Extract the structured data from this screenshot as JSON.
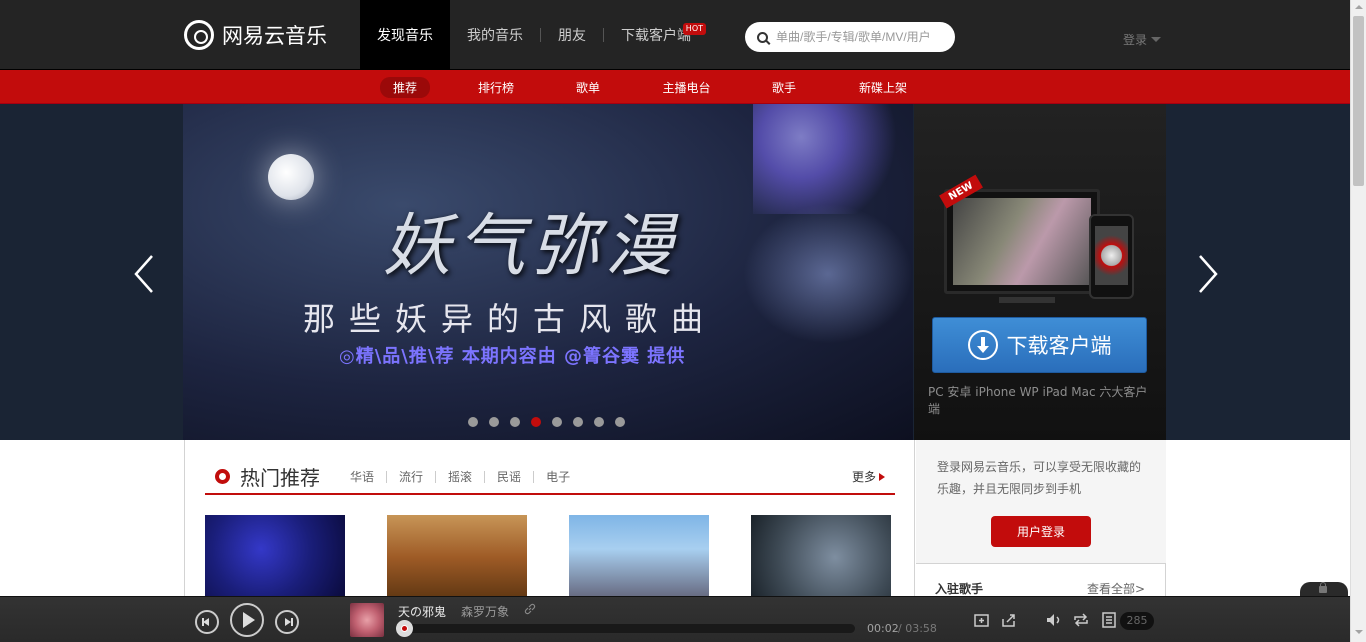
{
  "header": {
    "logo_text": "网易云音乐",
    "nav": [
      {
        "label": "发现音乐"
      },
      {
        "label": "我的音乐"
      },
      {
        "label": "朋友"
      },
      {
        "label": "下载客户端",
        "badge": "HOT"
      }
    ],
    "search": {
      "placeholder": "单曲/歌手/专辑/歌单/MV/用户",
      "value": ""
    },
    "login_label": "登录"
  },
  "subnav": {
    "items": [
      "推荐",
      "排行榜",
      "歌单",
      "主播电台",
      "歌手",
      "新碟上架"
    ],
    "active_index": 0
  },
  "banner": {
    "title": "妖气弥漫",
    "subtitle": "那些妖异的古风歌曲",
    "tagline": "◎精\\品\\推\\荐  本期内容由 @箐谷霙 提供",
    "dots_total": 8,
    "active_dot": 3
  },
  "download_panel": {
    "ribbon": "NEW",
    "button_label": "下载客户端",
    "platforms": "PC 安卓 iPhone WP iPad Mac 六大客户端"
  },
  "hot": {
    "title": "热门推荐",
    "tags": [
      "华语",
      "流行",
      "摇滚",
      "民谣",
      "电子"
    ],
    "more_label": "更多"
  },
  "sidebar": {
    "login_text": "登录网易云音乐，可以享受无限收藏的乐趣，并且无限同步到手机",
    "login_button": "用户登录",
    "singers_title": "入驻歌手",
    "view_all": "查看全部>"
  },
  "player": {
    "song": "天の邪鬼",
    "artist": "森罗万象",
    "current_time": "00:02",
    "total_time": "/ 03:58",
    "progress_fraction": 0.008,
    "playlist_count": "285"
  },
  "colors": {
    "brand_red": "#c20c0c",
    "header_bg": "#242424",
    "download_blue": "#2a6ebb"
  }
}
